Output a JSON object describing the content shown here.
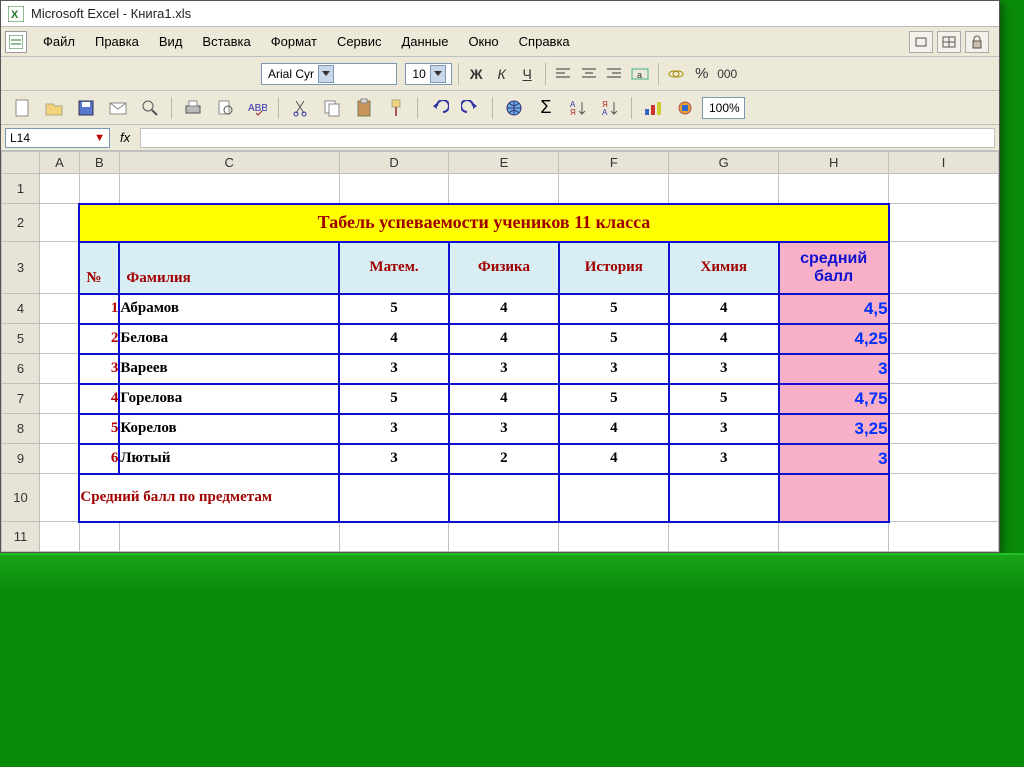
{
  "app": {
    "title": "Microsoft Excel - Книга1.xls"
  },
  "menu": {
    "file": "Файл",
    "edit": "Правка",
    "view": "Вид",
    "insert": "Вставка",
    "format": "Формат",
    "service": "Сервис",
    "data": "Данные",
    "window": "Окно",
    "help": "Справка"
  },
  "fmt": {
    "font": "Arial Cyr",
    "size": "10",
    "bold": "Ж",
    "italic": "К",
    "underline": "Ч",
    "pct": "%",
    "thousands": "000"
  },
  "std": {
    "zoom": "100%"
  },
  "formula": {
    "cell_ref": "L14",
    "fx": "fx"
  },
  "columns": [
    "A",
    "B",
    "C",
    "D",
    "E",
    "F",
    "G",
    "H",
    "I"
  ],
  "rows": [
    "1",
    "2",
    "3",
    "4",
    "5",
    "6",
    "7",
    "8",
    "9",
    "10",
    "11"
  ],
  "report": {
    "title": "Табель успеваемости учеников 11  класса",
    "num_hdr": "№",
    "name_hdr": "Фамилия",
    "subj": [
      "Матем.",
      "Физика",
      "История",
      "Химия"
    ],
    "avg_hdr_l1": "средний",
    "avg_hdr_l2": "балл",
    "students": [
      {
        "n": "1",
        "name": "Абрамов",
        "s": [
          "5",
          "4",
          "5",
          "4"
        ],
        "avg": "4,5"
      },
      {
        "n": "2",
        "name": "Белова",
        "s": [
          "4",
          "4",
          "5",
          "4"
        ],
        "avg": "4,25"
      },
      {
        "n": "3",
        "name": "Вареев",
        "s": [
          "3",
          "3",
          "3",
          "3"
        ],
        "avg": "3"
      },
      {
        "n": "4",
        "name": "Горелова",
        "s": [
          "5",
          "4",
          "5",
          "5"
        ],
        "avg": "4,75"
      },
      {
        "n": "5",
        "name": "Корелов",
        "s": [
          "3",
          "3",
          "4",
          "3"
        ],
        "avg": "3,25"
      },
      {
        "n": "6",
        "name": "Лютый",
        "s": [
          "3",
          "2",
          "4",
          "3"
        ],
        "avg": "3"
      }
    ],
    "foot_label": "Средний балл по предметам"
  },
  "chart_data": {
    "type": "table",
    "title": "Табель успеваемости учеников 11 класса",
    "columns": [
      "№",
      "Фамилия",
      "Матем.",
      "Физика",
      "История",
      "Химия",
      "средний балл"
    ],
    "rows": [
      [
        1,
        "Абрамов",
        5,
        4,
        5,
        4,
        4.5
      ],
      [
        2,
        "Белова",
        4,
        4,
        5,
        4,
        4.25
      ],
      [
        3,
        "Вареев",
        3,
        3,
        3,
        3,
        3
      ],
      [
        4,
        "Горелова",
        5,
        4,
        5,
        5,
        4.75
      ],
      [
        5,
        "Корелов",
        3,
        3,
        4,
        3,
        3.25
      ],
      [
        6,
        "Лютый",
        3,
        2,
        4,
        3,
        3
      ]
    ]
  }
}
